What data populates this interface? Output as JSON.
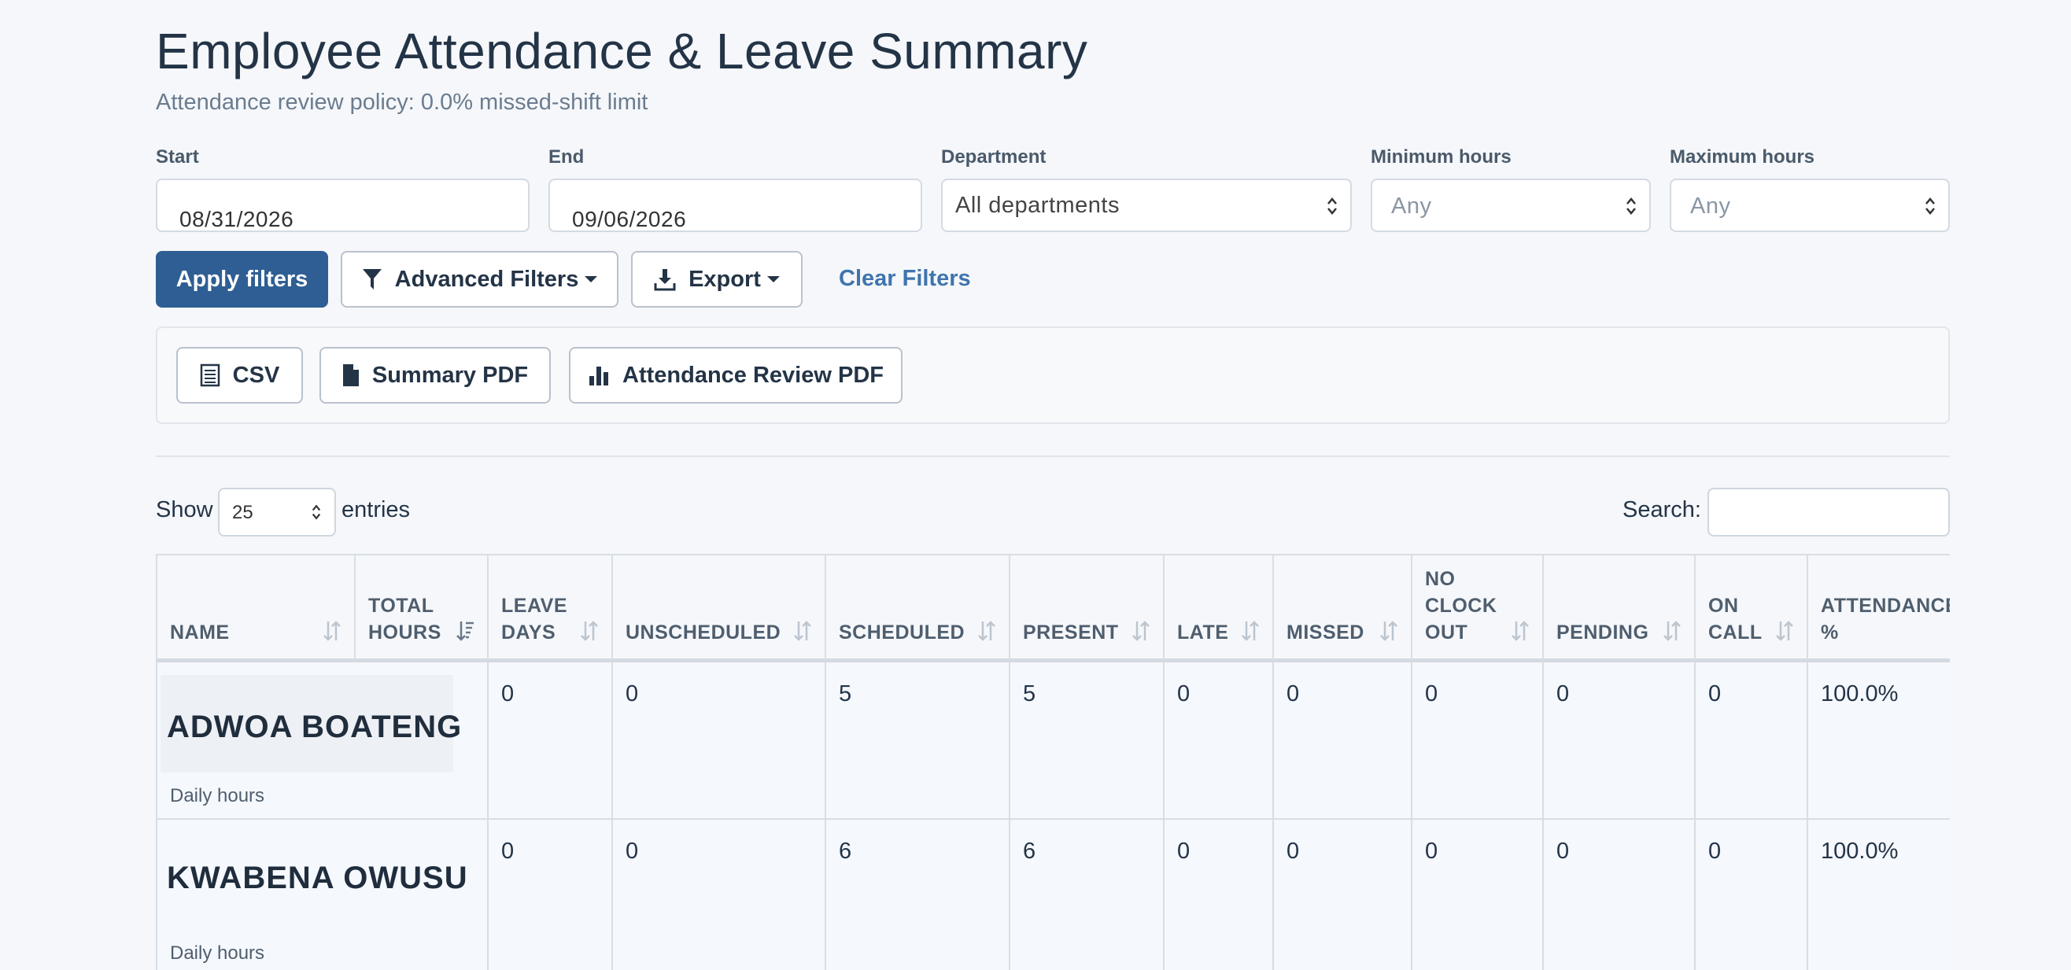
{
  "header": {
    "title": "Employee Attendance & Leave Summary",
    "subtitle": "Attendance review policy: 0.0% missed-shift limit"
  },
  "filters": {
    "start_label": "Start",
    "start_value": "08/31/2026",
    "end_label": "End",
    "end_value": "09/06/2026",
    "department_label": "Department",
    "department_value": "All departments",
    "min_hours_label": "Minimum hours",
    "min_hours_placeholder": "Any",
    "max_hours_label": "Maximum hours",
    "max_hours_placeholder": "Any"
  },
  "actions": {
    "apply": "Apply filters",
    "advanced": "Advanced Filters",
    "export": "Export",
    "clear": "Clear Filters"
  },
  "export_options": {
    "csv": "CSV",
    "summary_pdf": "Summary PDF",
    "review_pdf": "Attendance Review PDF"
  },
  "table_controls": {
    "show_label": "Show",
    "page_length": "25",
    "entries_label": "entries",
    "search_label": "Search:"
  },
  "columns": [
    {
      "label": "NAME"
    },
    {
      "label": "TOTAL HOURS"
    },
    {
      "label": "LEAVE DAYS"
    },
    {
      "label": "UNSCHEDULED"
    },
    {
      "label": "SCHEDULED"
    },
    {
      "label": "PRESENT"
    },
    {
      "label": "LATE"
    },
    {
      "label": "MISSED"
    },
    {
      "label": "NO CLOCK OUT"
    },
    {
      "label": "PENDING"
    },
    {
      "label": "ON CALL"
    },
    {
      "label": "ATTENDANCE %"
    }
  ],
  "rows": [
    {
      "name": "ADWOA BOATENG",
      "sub": "Daily hours",
      "total_hours": "",
      "leave_days": "0",
      "unscheduled": "0",
      "scheduled": "5",
      "present": "5",
      "late": "0",
      "missed": "0",
      "no_clock_out": "0",
      "pending": "0",
      "on_call": "0",
      "attendance": "100.0%"
    },
    {
      "name": "KWABENA OWUSU",
      "sub": "Daily hours",
      "total_hours": "",
      "leave_days": "0",
      "unscheduled": "0",
      "scheduled": "6",
      "present": "6",
      "late": "0",
      "missed": "0",
      "no_clock_out": "0",
      "pending": "0",
      "on_call": "0",
      "attendance": "100.0%"
    }
  ]
}
